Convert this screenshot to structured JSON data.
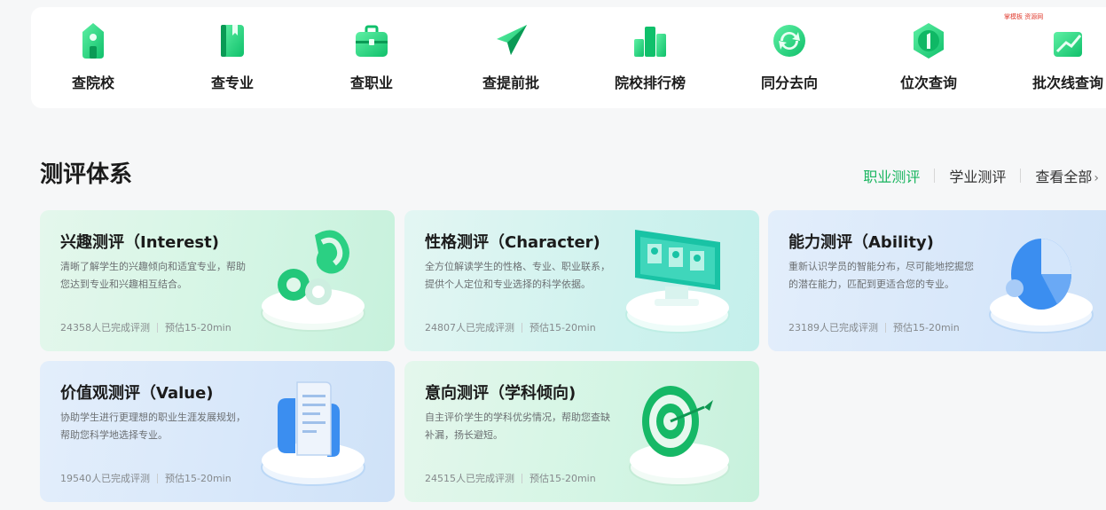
{
  "quick_nav": [
    {
      "label": "查院校",
      "icon": "school-building-icon"
    },
    {
      "label": "查专业",
      "icon": "book-icon"
    },
    {
      "label": "查职业",
      "icon": "briefcase-icon"
    },
    {
      "label": "查提前批",
      "icon": "paper-plane-icon"
    },
    {
      "label": "院校排行榜",
      "icon": "ranking-bars-icon"
    },
    {
      "label": "同分去向",
      "icon": "refresh-arrows-icon"
    },
    {
      "label": "位次查询",
      "icon": "rank-badge-icon"
    },
    {
      "label": "批次线查询",
      "icon": "batch-line-icon"
    }
  ],
  "watermark": "掌模板 资源网",
  "section": {
    "title": "测评体系",
    "tabs": [
      "职业测评",
      "学业测评",
      "查看全部"
    ],
    "active_tab": "职业测评"
  },
  "cards": [
    {
      "title": "兴趣测评（Interest)",
      "desc": "清晰了解学生的兴趣倾向和适宜专业，帮助您达到专业和兴趣相互结合。",
      "count": "24358人已完成评测",
      "duration": "预估15-20min",
      "icon": "riasec-shapes-icon"
    },
    {
      "title": "性格测评（Character)",
      "desc": "全方位解读学生的性格、专业、职业联系，提供个人定位和专业选择的科学依据。",
      "count": "24807人已完成评测",
      "duration": "预估15-20min",
      "icon": "monitor-profiles-icon"
    },
    {
      "title": "能力测评（Ability)",
      "desc": "重新认识学员的智能分布，尽可能地挖掘您的潜在能力，匹配到更适合您的专业。",
      "count": "23189人已完成评测",
      "duration": "预估15-20min",
      "icon": "pie-chart-icon"
    },
    {
      "title": "价值观测评（Value)",
      "desc": "协助学生进行更理想的职业生涯发展规划，帮助您科学地选择专业。",
      "count": "19540人已完成评测",
      "duration": "预估15-20min",
      "icon": "document-scroll-icon"
    },
    {
      "title": "意向测评（学科倾向)",
      "desc": "自主评价学生的学科优劣情况，帮助您查缺补漏，扬长避短。",
      "count": "24515人已完成评测",
      "duration": "预估15-20min",
      "icon": "target-icon"
    }
  ],
  "colors": {
    "accent": "#19b55f",
    "card_green": "#d3f5e4",
    "card_cyan": "#cff2ee",
    "card_blue": "#d7e7fa"
  }
}
